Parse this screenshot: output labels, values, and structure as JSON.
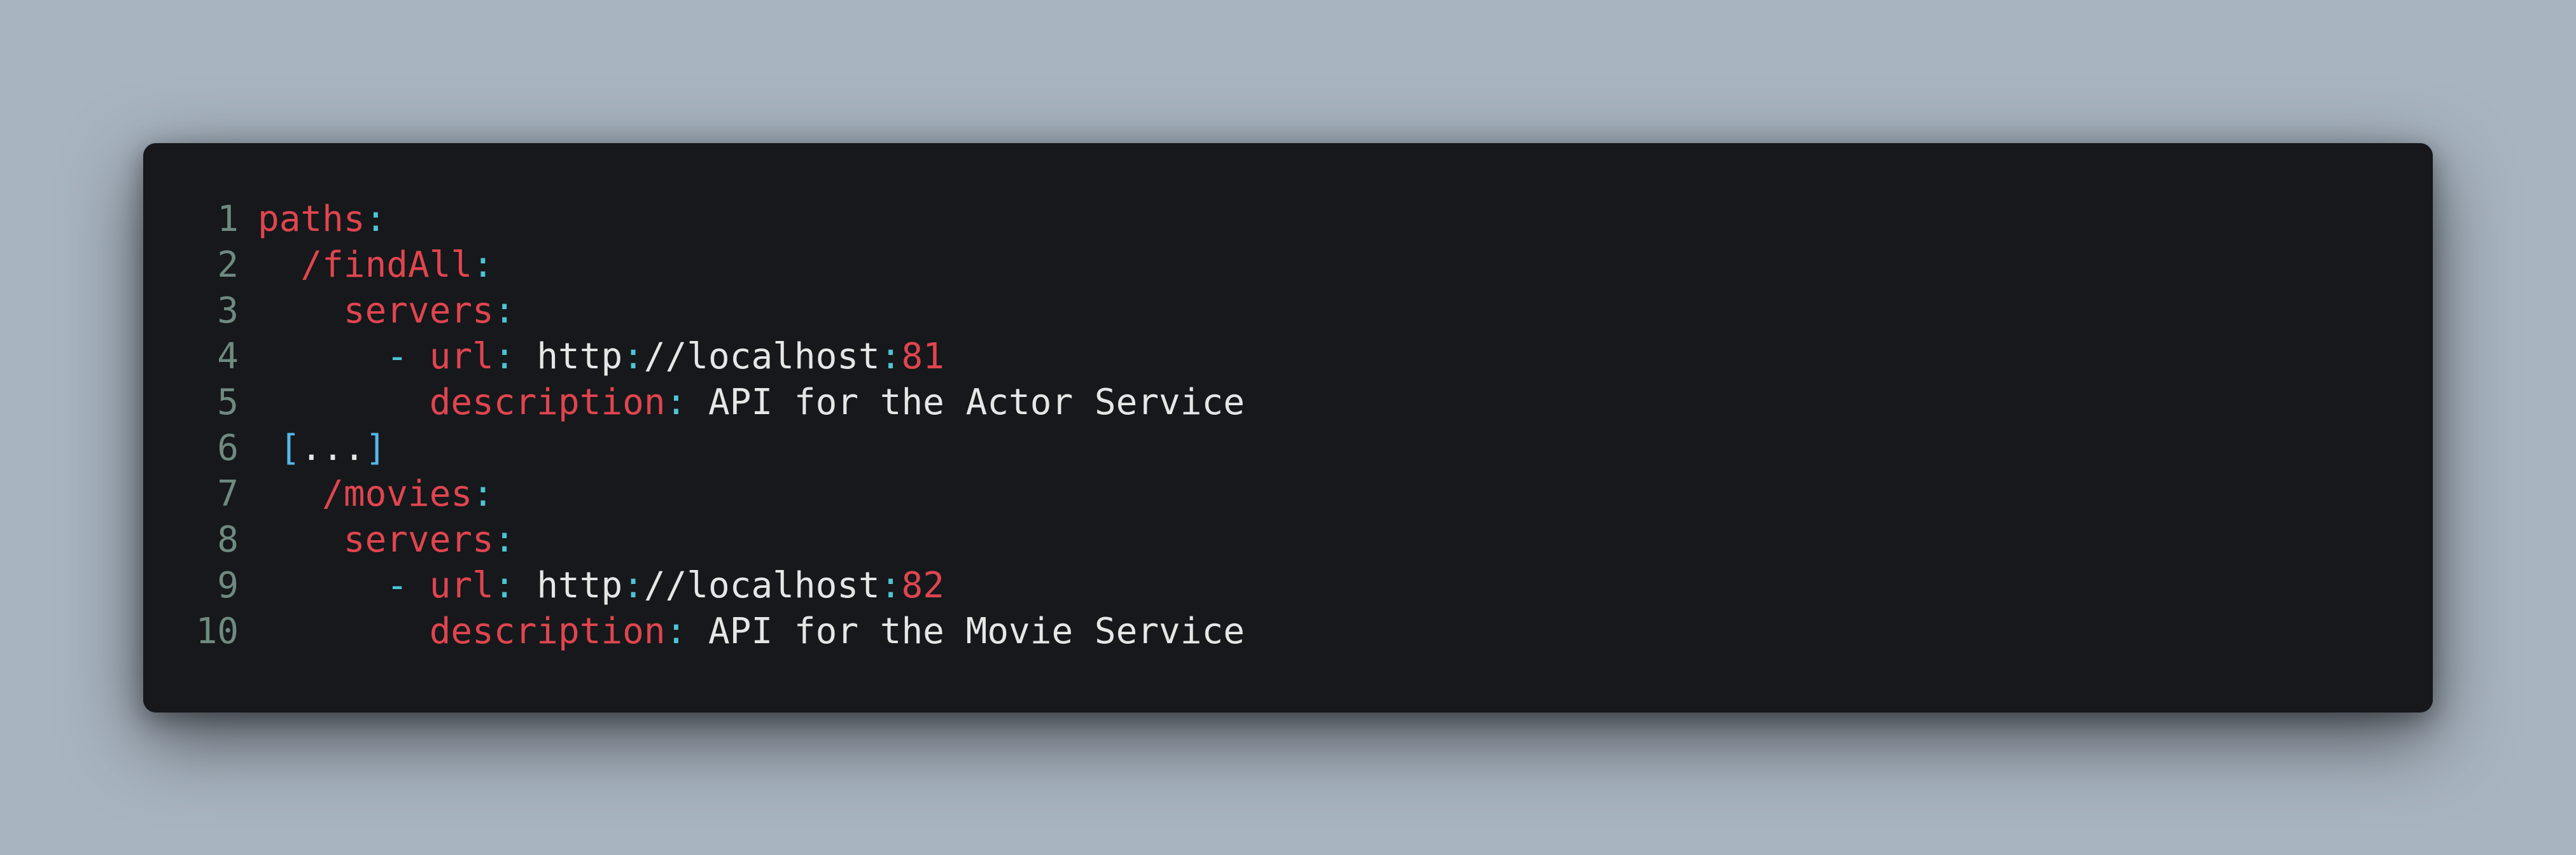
{
  "lines": [
    {
      "num": "1",
      "indent": "",
      "key": "paths",
      "colon": ":"
    },
    {
      "num": "2",
      "indent": "  ",
      "key": "/findAll",
      "colon": ":"
    },
    {
      "num": "3",
      "indent": "    ",
      "key": "servers",
      "colon": ":"
    },
    {
      "num": "4",
      "indent": "      ",
      "dash": "- ",
      "key": "url",
      "colon": ": ",
      "value_prefix": "http",
      "value_colon": ":",
      "value_mid": "//localhost",
      "port_colon": ":",
      "port": "81"
    },
    {
      "num": "5",
      "indent": "        ",
      "key": "description",
      "colon": ": ",
      "value": "API for the Actor Service"
    },
    {
      "num": "6",
      "indent": " ",
      "bracket_open": "[",
      "ellipsis": "...",
      "bracket_close": "]"
    },
    {
      "num": "7",
      "indent": "   ",
      "key": "/movies",
      "colon": ":"
    },
    {
      "num": "8",
      "indent": "    ",
      "key": "servers",
      "colon": ":"
    },
    {
      "num": "9",
      "indent": "      ",
      "dash": "- ",
      "key": "url",
      "colon": ": ",
      "value_prefix": "http",
      "value_colon": ":",
      "value_mid": "//localhost",
      "port_colon": ":",
      "port": "82"
    },
    {
      "num": "10",
      "indent": "        ",
      "key": "description",
      "colon": ": ",
      "value": "API for the Movie Service"
    }
  ],
  "colors": {
    "background": "#a8b4c0",
    "editor_bg": "#16181b",
    "line_number": "#6f8a80",
    "key": "#e0454f",
    "punctuation": "#4dc4d6",
    "text": "#e6e6e6",
    "bracket": "#56b6e8"
  }
}
